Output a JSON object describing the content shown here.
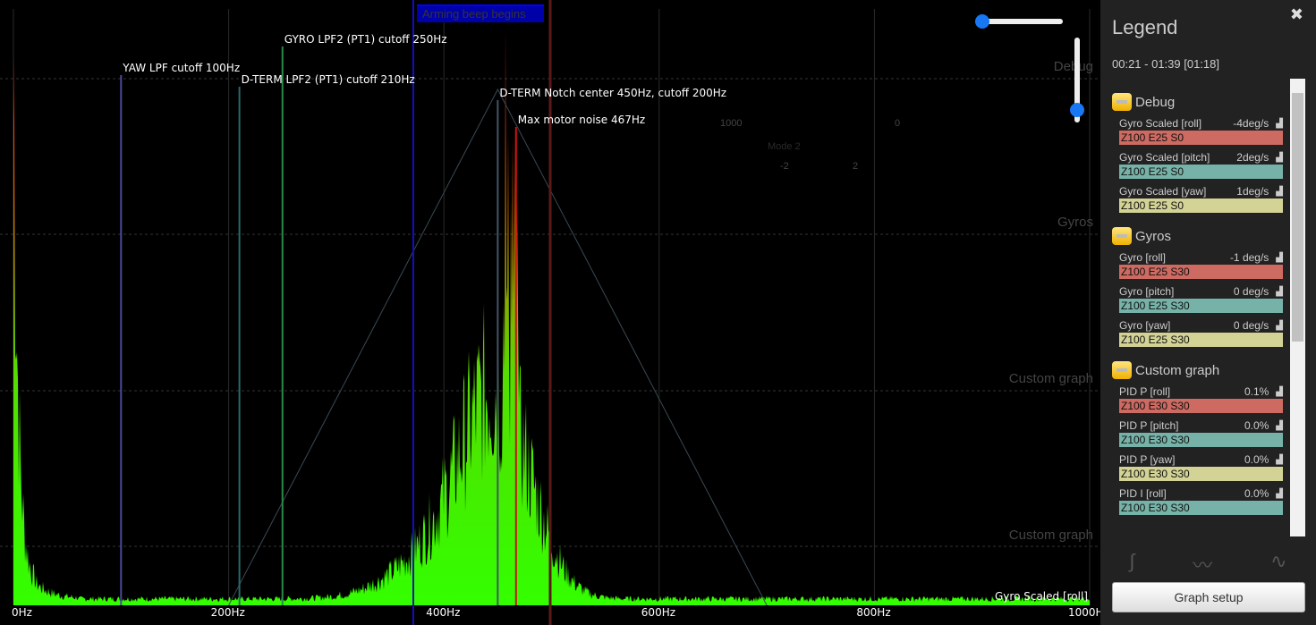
{
  "plot": {
    "x_ticks": [
      "0Hz",
      "200Hz",
      "400Hz",
      "600Hz",
      "800Hz",
      "1000Hz"
    ],
    "x_range_hz": [
      0,
      1000
    ],
    "markers": [
      {
        "label": "YAW LPF cutoff 100Hz",
        "hz": 100,
        "color": "#4a4a9a"
      },
      {
        "label": "D-TERM LPF2 (PT1) cutoff 210Hz",
        "hz": 210,
        "color": "#2a6a6a"
      },
      {
        "label": "GYRO LPF2 (PT1) cutoff 250Hz",
        "hz": 250,
        "color": "#2a8a4a"
      },
      {
        "label": "D-TERM Notch center 450Hz, cutoff 200Hz",
        "hz": 450,
        "color": "#445566"
      },
      {
        "label": "Max motor noise 467Hz",
        "hz": 467,
        "color": "#cc1111"
      }
    ],
    "event_label": "Arming beep begins",
    "graph_labels": [
      "Debug",
      "Gyros",
      "Custom graph",
      "Custom graph"
    ],
    "curve_label": "Gyro Scaled [roll]",
    "stick_values": {
      "left_x": "-2",
      "left_y": "1000",
      "right_x": "2",
      "right_y": "0",
      "mode": "Mode 2"
    },
    "spectrum_color_low": "#33ff00",
    "spectrum_color_high": "#ff2020"
  },
  "legend": {
    "title": "Legend",
    "range": "00:21 - 01:39 [01:18]",
    "groups": [
      {
        "name": "Debug",
        "items": [
          {
            "name": "Gyro Scaled [roll]",
            "value": "-4deg/s",
            "setting": "Z100 E25 S0",
            "color": "#cd6a61"
          },
          {
            "name": "Gyro Scaled [pitch]",
            "value": "2deg/s",
            "setting": "Z100 E25 S0",
            "color": "#77b2a8"
          },
          {
            "name": "Gyro Scaled [yaw]",
            "value": "1deg/s",
            "setting": "Z100 E25 S0",
            "color": "#d3d396"
          }
        ]
      },
      {
        "name": "Gyros",
        "items": [
          {
            "name": "Gyro [roll]",
            "value": "-1 deg/s",
            "setting": "Z100 E25 S30",
            "color": "#cd6a61"
          },
          {
            "name": "Gyro [pitch]",
            "value": "0 deg/s",
            "setting": "Z100 E25 S30",
            "color": "#77b2a8"
          },
          {
            "name": "Gyro [yaw]",
            "value": "0 deg/s",
            "setting": "Z100 E25 S30",
            "color": "#d3d396"
          }
        ]
      },
      {
        "name": "Custom graph",
        "items": [
          {
            "name": "PID P [roll]",
            "value": "0.1%",
            "setting": "Z100 E30 S30",
            "color": "#cd6a61"
          },
          {
            "name": "PID P [pitch]",
            "value": "0.0%",
            "setting": "Z100 E30 S30",
            "color": "#77b2a8"
          },
          {
            "name": "PID P [yaw]",
            "value": "0.0%",
            "setting": "Z100 E30 S30",
            "color": "#d3d396"
          },
          {
            "name": "PID I [roll]",
            "value": "0.0%",
            "setting": "Z100 E30 S30",
            "color": "#77b2a8"
          }
        ]
      }
    ],
    "graph_setup": "Graph setup"
  }
}
